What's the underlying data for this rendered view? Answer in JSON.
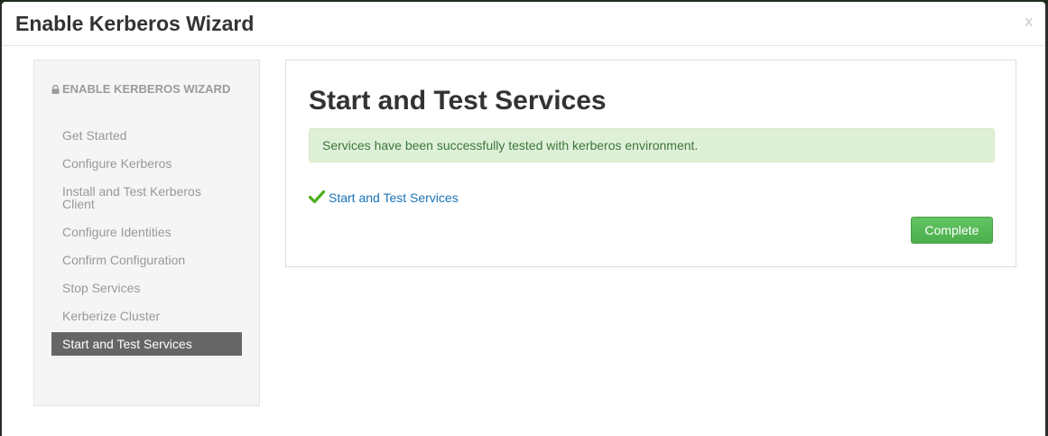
{
  "modal": {
    "title": "Enable Kerberos Wizard",
    "close_label": "x"
  },
  "sidebar": {
    "header": "ENABLE KERBEROS WIZARD",
    "items": [
      {
        "label": "Get Started",
        "active": false
      },
      {
        "label": "Configure Kerberos",
        "active": false
      },
      {
        "label": "Install and Test Kerberos Client",
        "active": false
      },
      {
        "label": "Configure Identities",
        "active": false
      },
      {
        "label": "Confirm Configuration",
        "active": false
      },
      {
        "label": "Stop Services",
        "active": false
      },
      {
        "label": "Kerberize Cluster",
        "active": false
      },
      {
        "label": "Start and Test Services",
        "active": true
      }
    ]
  },
  "main": {
    "title": "Start and Test Services",
    "alert": "Services have been successfully tested with kerberos environment.",
    "task_label": "Start and Test Services",
    "complete_label": "Complete"
  },
  "colors": {
    "success_green": "#5cb85c",
    "link_blue": "#1a73b8",
    "active_item_bg": "#666666",
    "alert_bg": "#dff0d8"
  },
  "icons": [
    "lock-icon",
    "check-icon"
  ]
}
